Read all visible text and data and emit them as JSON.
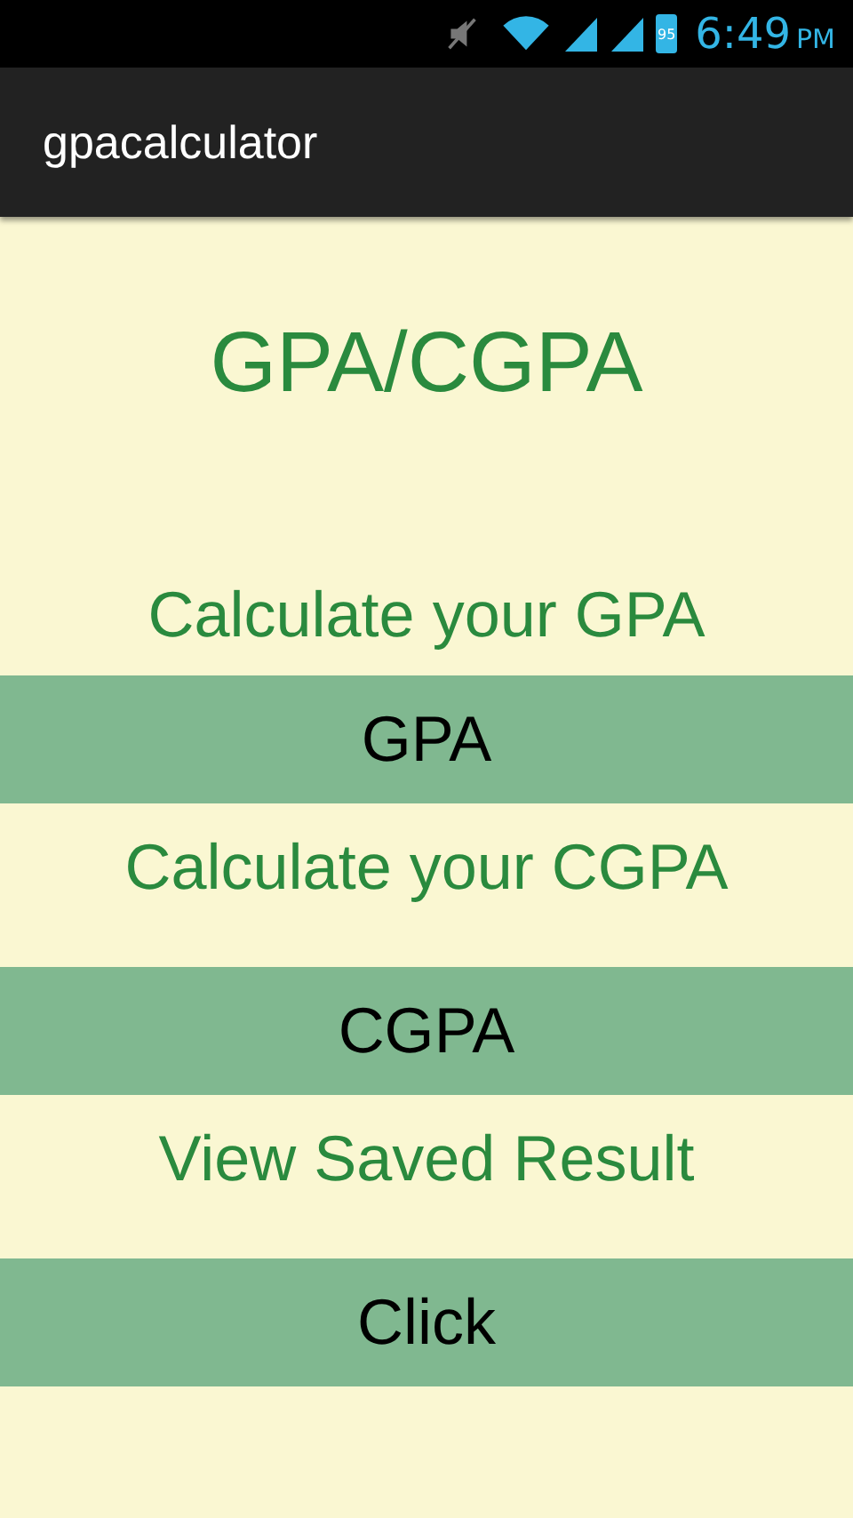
{
  "status_bar": {
    "battery": "95",
    "time": "6:49",
    "period": "PM"
  },
  "action_bar": {
    "title": "gpacalculator"
  },
  "heading": "GPA/CGPA",
  "sections": [
    {
      "prompt": "Calculate your GPA",
      "button": "GPA"
    },
    {
      "prompt": "Calculate your CGPA",
      "button": "CGPA"
    },
    {
      "prompt": "View Saved Result",
      "button": "Click"
    }
  ]
}
